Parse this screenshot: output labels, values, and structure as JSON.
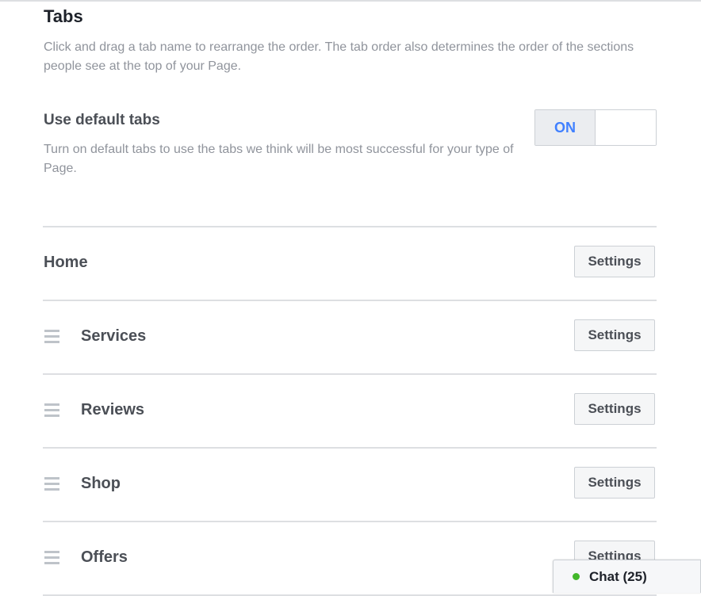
{
  "section": {
    "title": "Tabs",
    "description": "Click and drag a tab name to rearrange the order. The tab order also determines the order of the sections people see at the top of your Page."
  },
  "default_tabs": {
    "title": "Use default tabs",
    "description": "Turn on default tabs to use the tabs we think will be most successful for your type of Page.",
    "toggle_label": "ON",
    "toggle_state": "on"
  },
  "tabs": [
    {
      "label": "Home",
      "settings_label": "Settings",
      "draggable": false
    },
    {
      "label": "Services",
      "settings_label": "Settings",
      "draggable": true
    },
    {
      "label": "Reviews",
      "settings_label": "Settings",
      "draggable": true
    },
    {
      "label": "Shop",
      "settings_label": "Settings",
      "draggable": true
    },
    {
      "label": "Offers",
      "settings_label": "Settings",
      "draggable": true
    }
  ],
  "chat": {
    "label": "Chat (25)",
    "status_color": "#42b72a"
  },
  "colors": {
    "accent": "#4080ff",
    "border": "#dddfe2",
    "muted_text": "#90949c",
    "button_bg": "#f5f6f7"
  },
  "icons": {
    "drag_handle": "drag-handle-icon",
    "chat_status": "online-dot-icon"
  }
}
